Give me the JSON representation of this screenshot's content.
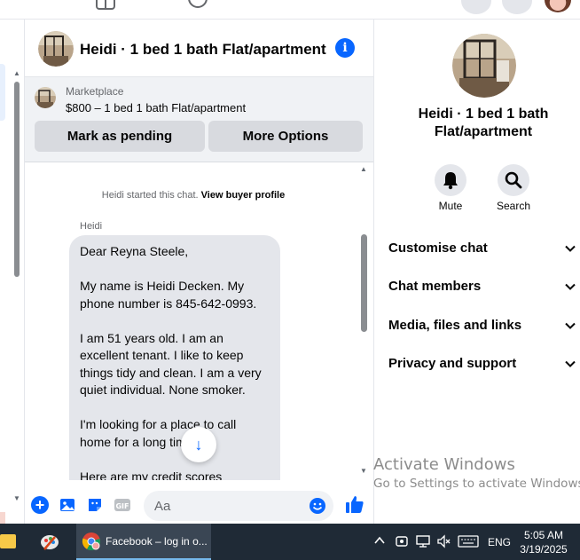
{
  "colors": {
    "accent": "#0866ff",
    "bubble_bg": "#e4e6eb",
    "listing_bg": "#f0f2f5",
    "taskbar_bg": "#1f2a36"
  },
  "chat": {
    "title": "Heidi · 1 bed 1 bath Flat/apartment",
    "info_icon": "info-icon"
  },
  "listing": {
    "kicker": "Marketplace",
    "price_line": "$800 – 1 bed 1 bath Flat/apartment",
    "mark_pending_label": "Mark as pending",
    "more_options_label": "More Options"
  },
  "messages": {
    "system_prefix": "Heidi started this chat.",
    "system_link": "View buyer profile",
    "sender": "Heidi",
    "bubble_paragraphs": [
      "Dear Reyna Steele,",
      "My name is Heidi Decken. My phone number is 845-642-0993.",
      "I am 51 years old. I am an excellent tenant. I like to keep things tidy and clean. I am a very quiet individual. None  smoker.",
      "I'm looking for a place to call home for a long time.",
      "Here are my credit scores"
    ]
  },
  "composer": {
    "placeholder": "Aa"
  },
  "right_panel": {
    "name": "Heidi · 1 bed 1 bath Flat/apartment",
    "mute_label": "Mute",
    "search_label": "Search",
    "menu": [
      {
        "label": "Customise chat"
      },
      {
        "label": "Chat members"
      },
      {
        "label": "Media, files and links"
      },
      {
        "label": "Privacy and support"
      }
    ]
  },
  "watermark": {
    "line1": "Activate Windows",
    "line2": "Go to Settings to activate Windows."
  },
  "taskbar": {
    "chrome_label": "Facebook – log in o...",
    "lang": "ENG",
    "time": "5:05 AM",
    "date": "3/19/2025"
  }
}
